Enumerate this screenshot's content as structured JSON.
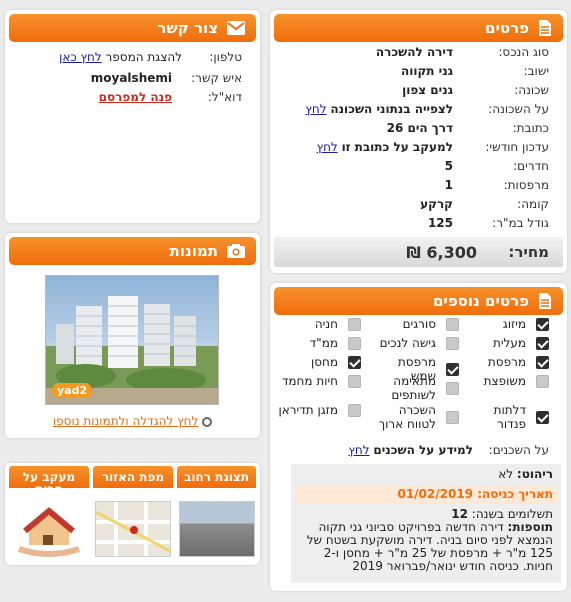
{
  "contact": {
    "title": "צור קשר",
    "phone_label": "טלפון:",
    "phone_text": "להצגת המספר",
    "phone_link": "לחץ כאן",
    "person_label": "איש קשר:",
    "person_value": "moyalshemi",
    "email_label": "דוא\"ל:",
    "email_link": "פנה למפרסם"
  },
  "details": {
    "title": "פרטים",
    "rows": [
      {
        "label": "סוג הנכס:",
        "value": "דירה להשכרה"
      },
      {
        "label": "ישוב:",
        "value": "גני תקווה"
      },
      {
        "label": "שכונה:",
        "value": "גנים צפון"
      },
      {
        "label": "על השכונה:",
        "value": "לצפייה בנתוני השכונה",
        "link": "לחץ"
      },
      {
        "label": "כתובת:",
        "value": "דרך הים 26"
      },
      {
        "label": "עדכון חודשי:",
        "value": "למעקב על כתובת זו",
        "link": "לחץ"
      },
      {
        "label": "חדרים:",
        "value": "5"
      },
      {
        "label": "מרפסות:",
        "value": "1"
      },
      {
        "label": "קומה:",
        "value": "קרקע"
      },
      {
        "label": "גודל במ\"ר:",
        "value": "125"
      }
    ],
    "price_label": "מחיר:",
    "price_value": "6,300 ₪"
  },
  "photos": {
    "title": "תמונות",
    "watermark": "yad2",
    "enlarge_link": "לחץ להגדלה ולתמונות נוספו"
  },
  "tabs": [
    "תצוגת רחוב",
    "מפת האזור",
    "מעקב על הבית"
  ],
  "extras": {
    "title": "פרטים נוספים",
    "features": [
      {
        "label": "מיזוג",
        "checked": true
      },
      {
        "label": "סורגים",
        "checked": false
      },
      {
        "label": "חניה",
        "checked": false
      },
      {
        "label": "מעלית",
        "checked": true
      },
      {
        "label": "גישה לנכים",
        "checked": false
      },
      {
        "label": "ממ\"ד",
        "checked": false
      },
      {
        "label": "מרפסת",
        "checked": true
      },
      {
        "label": "מרפסת שמש",
        "checked": true
      },
      {
        "label": "מחסן",
        "checked": true
      },
      {
        "label": "משופצת",
        "checked": false
      },
      {
        "label": "מתאימה לשותפים",
        "checked": false
      },
      {
        "label": "חיות מחמד",
        "checked": false
      },
      {
        "label": "דלתות פנדור",
        "checked": true
      },
      {
        "label": "השכרה לטווח ארוך",
        "checked": false
      },
      {
        "label": "מזגן תדיראן",
        "checked": false
      }
    ],
    "neighbors_label": "על השכנים:",
    "neighbors_value": "למידע על השכנים",
    "neighbors_link": "לחץ",
    "furniture_label": "ריהוט:",
    "furniture_value": "לא",
    "entry_label": "תאריך כניסה:",
    "entry_value": "01/02/2019",
    "payments_label": "תשלומים בשנה:",
    "payments_value": "12",
    "notes_label": "תוספות:",
    "notes_value": "דירה חדשה בפרויקט סביוני גני תקוה הנמצא לפני סיום בניה. דירה מושקעת בשטח של 125 מ\"ר + מרפסת של 25 מ\"ר + מחסן ו-2 חניות. כניסה חודש ינואר/פברואר 2019"
  },
  "colors": {
    "accent": "#ef6d0c",
    "link": "#1a1aa6",
    "alert": "#d4271b"
  }
}
